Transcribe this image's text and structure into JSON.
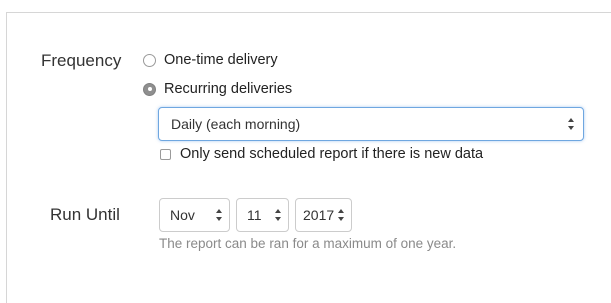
{
  "frequency": {
    "label": "Frequency",
    "options": [
      {
        "label": "One-time delivery",
        "checked": false
      },
      {
        "label": "Recurring deliveries",
        "checked": true
      }
    ],
    "schedule_select": {
      "value": "Daily (each morning)"
    },
    "only_new_data": {
      "label": "Only send scheduled report if there is new data",
      "checked": false
    }
  },
  "run_until": {
    "label": "Run Until",
    "month": "Nov",
    "day": "11",
    "year": "2017",
    "help": "The report can be ran for a maximum of one year."
  },
  "colors": {
    "focus_border": "#6fa7e0",
    "help_text": "#8a8a8a"
  }
}
